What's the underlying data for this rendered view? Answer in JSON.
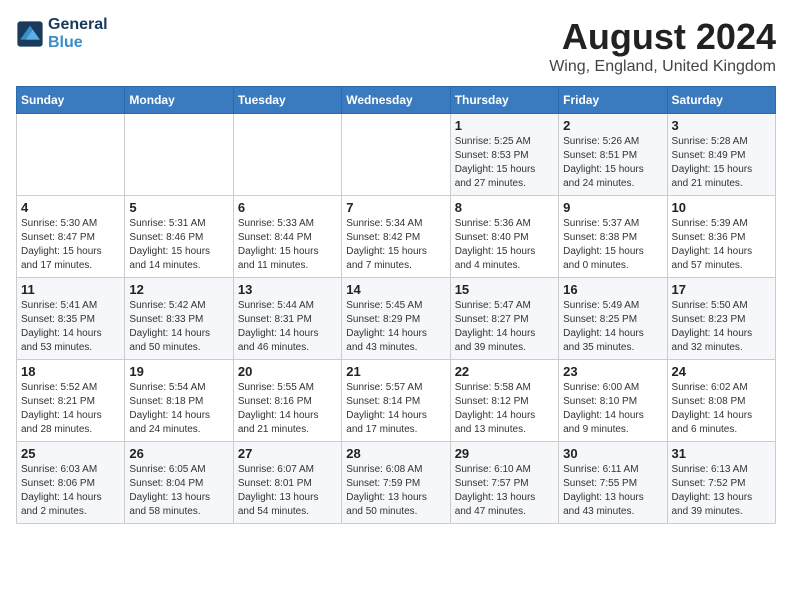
{
  "header": {
    "logo_line1": "General",
    "logo_line2": "Blue",
    "month_title": "August 2024",
    "location": "Wing, England, United Kingdom"
  },
  "days_of_week": [
    "Sunday",
    "Monday",
    "Tuesday",
    "Wednesday",
    "Thursday",
    "Friday",
    "Saturday"
  ],
  "weeks": [
    [
      {
        "day": "",
        "info": ""
      },
      {
        "day": "",
        "info": ""
      },
      {
        "day": "",
        "info": ""
      },
      {
        "day": "",
        "info": ""
      },
      {
        "day": "1",
        "info": "Sunrise: 5:25 AM\nSunset: 8:53 PM\nDaylight: 15 hours\nand 27 minutes."
      },
      {
        "day": "2",
        "info": "Sunrise: 5:26 AM\nSunset: 8:51 PM\nDaylight: 15 hours\nand 24 minutes."
      },
      {
        "day": "3",
        "info": "Sunrise: 5:28 AM\nSunset: 8:49 PM\nDaylight: 15 hours\nand 21 minutes."
      }
    ],
    [
      {
        "day": "4",
        "info": "Sunrise: 5:30 AM\nSunset: 8:47 PM\nDaylight: 15 hours\nand 17 minutes."
      },
      {
        "day": "5",
        "info": "Sunrise: 5:31 AM\nSunset: 8:46 PM\nDaylight: 15 hours\nand 14 minutes."
      },
      {
        "day": "6",
        "info": "Sunrise: 5:33 AM\nSunset: 8:44 PM\nDaylight: 15 hours\nand 11 minutes."
      },
      {
        "day": "7",
        "info": "Sunrise: 5:34 AM\nSunset: 8:42 PM\nDaylight: 15 hours\nand 7 minutes."
      },
      {
        "day": "8",
        "info": "Sunrise: 5:36 AM\nSunset: 8:40 PM\nDaylight: 15 hours\nand 4 minutes."
      },
      {
        "day": "9",
        "info": "Sunrise: 5:37 AM\nSunset: 8:38 PM\nDaylight: 15 hours\nand 0 minutes."
      },
      {
        "day": "10",
        "info": "Sunrise: 5:39 AM\nSunset: 8:36 PM\nDaylight: 14 hours\nand 57 minutes."
      }
    ],
    [
      {
        "day": "11",
        "info": "Sunrise: 5:41 AM\nSunset: 8:35 PM\nDaylight: 14 hours\nand 53 minutes."
      },
      {
        "day": "12",
        "info": "Sunrise: 5:42 AM\nSunset: 8:33 PM\nDaylight: 14 hours\nand 50 minutes."
      },
      {
        "day": "13",
        "info": "Sunrise: 5:44 AM\nSunset: 8:31 PM\nDaylight: 14 hours\nand 46 minutes."
      },
      {
        "day": "14",
        "info": "Sunrise: 5:45 AM\nSunset: 8:29 PM\nDaylight: 14 hours\nand 43 minutes."
      },
      {
        "day": "15",
        "info": "Sunrise: 5:47 AM\nSunset: 8:27 PM\nDaylight: 14 hours\nand 39 minutes."
      },
      {
        "day": "16",
        "info": "Sunrise: 5:49 AM\nSunset: 8:25 PM\nDaylight: 14 hours\nand 35 minutes."
      },
      {
        "day": "17",
        "info": "Sunrise: 5:50 AM\nSunset: 8:23 PM\nDaylight: 14 hours\nand 32 minutes."
      }
    ],
    [
      {
        "day": "18",
        "info": "Sunrise: 5:52 AM\nSunset: 8:21 PM\nDaylight: 14 hours\nand 28 minutes."
      },
      {
        "day": "19",
        "info": "Sunrise: 5:54 AM\nSunset: 8:18 PM\nDaylight: 14 hours\nand 24 minutes."
      },
      {
        "day": "20",
        "info": "Sunrise: 5:55 AM\nSunset: 8:16 PM\nDaylight: 14 hours\nand 21 minutes."
      },
      {
        "day": "21",
        "info": "Sunrise: 5:57 AM\nSunset: 8:14 PM\nDaylight: 14 hours\nand 17 minutes."
      },
      {
        "day": "22",
        "info": "Sunrise: 5:58 AM\nSunset: 8:12 PM\nDaylight: 14 hours\nand 13 minutes."
      },
      {
        "day": "23",
        "info": "Sunrise: 6:00 AM\nSunset: 8:10 PM\nDaylight: 14 hours\nand 9 minutes."
      },
      {
        "day": "24",
        "info": "Sunrise: 6:02 AM\nSunset: 8:08 PM\nDaylight: 14 hours\nand 6 minutes."
      }
    ],
    [
      {
        "day": "25",
        "info": "Sunrise: 6:03 AM\nSunset: 8:06 PM\nDaylight: 14 hours\nand 2 minutes."
      },
      {
        "day": "26",
        "info": "Sunrise: 6:05 AM\nSunset: 8:04 PM\nDaylight: 13 hours\nand 58 minutes."
      },
      {
        "day": "27",
        "info": "Sunrise: 6:07 AM\nSunset: 8:01 PM\nDaylight: 13 hours\nand 54 minutes."
      },
      {
        "day": "28",
        "info": "Sunrise: 6:08 AM\nSunset: 7:59 PM\nDaylight: 13 hours\nand 50 minutes."
      },
      {
        "day": "29",
        "info": "Sunrise: 6:10 AM\nSunset: 7:57 PM\nDaylight: 13 hours\nand 47 minutes."
      },
      {
        "day": "30",
        "info": "Sunrise: 6:11 AM\nSunset: 7:55 PM\nDaylight: 13 hours\nand 43 minutes."
      },
      {
        "day": "31",
        "info": "Sunrise: 6:13 AM\nSunset: 7:52 PM\nDaylight: 13 hours\nand 39 minutes."
      }
    ]
  ]
}
